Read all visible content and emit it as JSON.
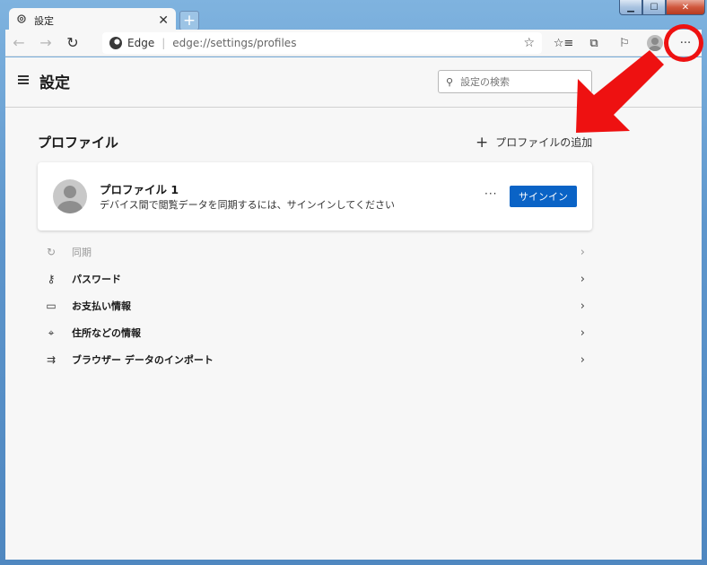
{
  "window": {
    "minimize": "▁",
    "maximize": "☐",
    "close": "✕"
  },
  "tab": {
    "title": "設定",
    "close": "✕",
    "new_tab": "+"
  },
  "toolbar": {
    "back": "←",
    "forward": "→",
    "refresh": "↻",
    "site_name": "Edge",
    "separator": "|",
    "url_host": "edge://",
    "url_path": "settings/profiles",
    "favorite": "☆",
    "favorites_list": "☆≡",
    "collections": "⧉",
    "share": "⚐",
    "more": "···"
  },
  "header": {
    "title": "設定",
    "search_placeholder": "設定の検索",
    "search_glyph": "⚲"
  },
  "profiles": {
    "section_title": "プロファイル",
    "add_profile": "プロファイルの追加",
    "add_plus": "+",
    "card": {
      "name": "プロファイル 1",
      "description": "デバイス間で閲覧データを同期するには、サインインしてください",
      "more": "···",
      "signin": "サインイン"
    },
    "items": [
      {
        "label": "同期",
        "icon": "↻",
        "chevron": "›"
      },
      {
        "label": "パスワード",
        "icon": "⚷",
        "chevron": "›"
      },
      {
        "label": "お支払い情報",
        "icon": "▭",
        "chevron": "›"
      },
      {
        "label": "住所などの情報",
        "icon": "⌖",
        "chevron": "›"
      },
      {
        "label": "ブラウザー データのインポート",
        "icon": "⇉",
        "chevron": "›"
      }
    ]
  },
  "colors": {
    "accent": "#0a63c6",
    "annotation": "#ee1111",
    "page_bg": "#f7f7f7"
  }
}
